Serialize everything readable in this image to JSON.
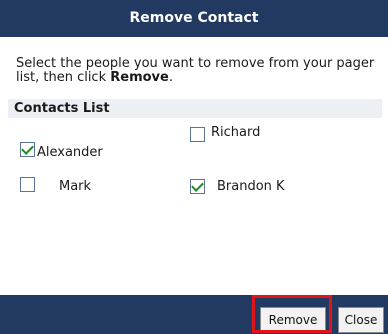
{
  "dialog": {
    "title": "Remove Contact",
    "instruction_before": "Select the people you want to remove from your pager list, then click ",
    "instruction_bold": "Remove",
    "instruction_after": ".",
    "list_header": "Contacts List"
  },
  "contacts": [
    {
      "name": "Alexander",
      "checked": true
    },
    {
      "name": "Richard",
      "checked": false
    },
    {
      "name": "Mark",
      "checked": false
    },
    {
      "name": "Brandon K",
      "checked": true
    }
  ],
  "buttons": {
    "remove_label": "Remove",
    "close_label": "Close"
  },
  "colors": {
    "header_bg": "#223a62",
    "highlight": "#e0151b"
  }
}
